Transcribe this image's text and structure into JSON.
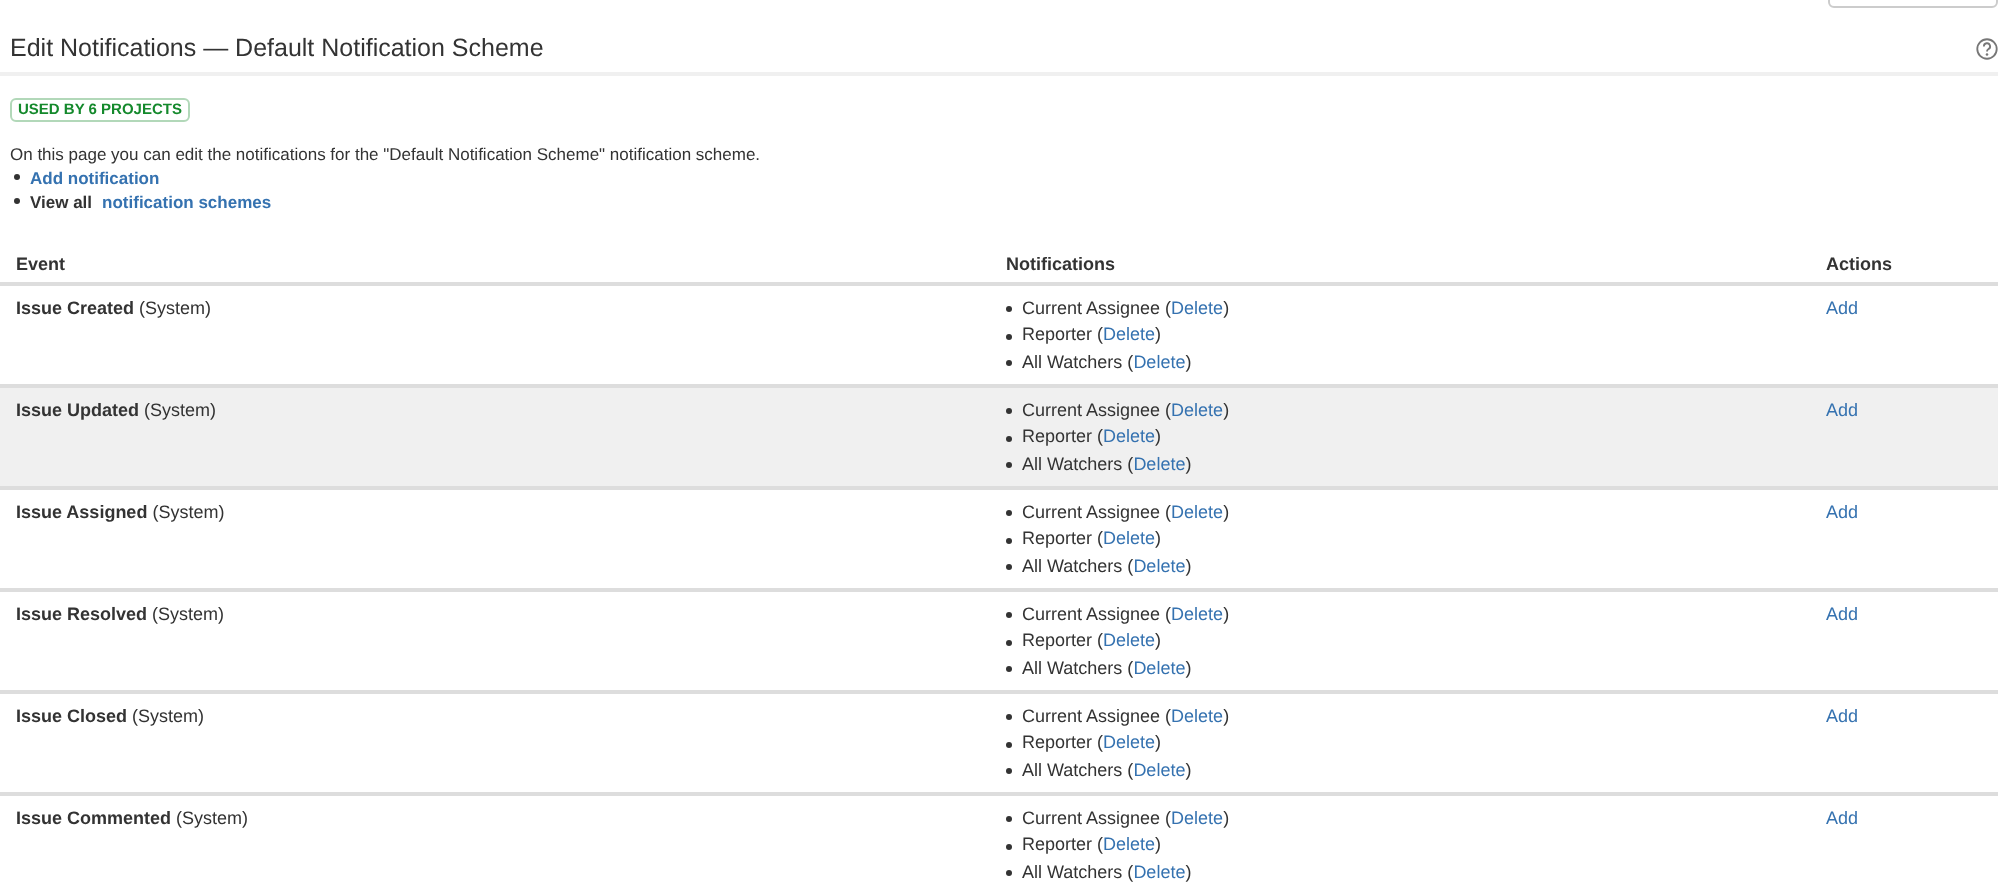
{
  "title": "Edit Notifications — Default Notification Scheme",
  "badge": "USED BY 6 PROJECTS",
  "description": "On this page you can edit the notifications for the \"Default Notification Scheme\" notification scheme.",
  "links": [
    {
      "link": "Add notification"
    },
    {
      "prefix": "View all",
      "link": "notification schemes"
    }
  ],
  "table": {
    "columns": [
      "Event",
      "Notifications",
      "Actions"
    ],
    "rows": [
      {
        "event": "Issue Created",
        "tag": "(System)",
        "highlighted": false,
        "notifications": [
          {
            "name": "Current Assignee (",
            "action": "Delete",
            "close": ")"
          },
          {
            "name": "Reporter (",
            "action": "Delete",
            "close": ")"
          },
          {
            "name": "All Watchers (",
            "action": "Delete",
            "close": ")"
          }
        ],
        "action": "Add"
      },
      {
        "event": "Issue Updated",
        "tag": "(System)",
        "highlighted": true,
        "notifications": [
          {
            "name": "Current Assignee (",
            "action": "Delete",
            "close": ")"
          },
          {
            "name": "Reporter (",
            "action": "Delete",
            "close": ")"
          },
          {
            "name": "All Watchers (",
            "action": "Delete",
            "close": ")"
          }
        ],
        "action": "Add"
      },
      {
        "event": "Issue Assigned",
        "tag": "(System)",
        "highlighted": false,
        "notifications": [
          {
            "name": "Current Assignee (",
            "action": "Delete",
            "close": ")"
          },
          {
            "name": "Reporter (",
            "action": "Delete",
            "close": ")"
          },
          {
            "name": "All Watchers (",
            "action": "Delete",
            "close": ")"
          }
        ],
        "action": "Add"
      },
      {
        "event": "Issue Resolved",
        "tag": "(System)",
        "highlighted": false,
        "notifications": [
          {
            "name": "Current Assignee (",
            "action": "Delete",
            "close": ")"
          },
          {
            "name": "Reporter (",
            "action": "Delete",
            "close": ")"
          },
          {
            "name": "All Watchers (",
            "action": "Delete",
            "close": ")"
          }
        ],
        "action": "Add"
      },
      {
        "event": "Issue Closed",
        "tag": "(System)",
        "highlighted": false,
        "notifications": [
          {
            "name": "Current Assignee (",
            "action": "Delete",
            "close": ")"
          },
          {
            "name": "Reporter (",
            "action": "Delete",
            "close": ")"
          },
          {
            "name": "All Watchers (",
            "action": "Delete",
            "close": ")"
          }
        ],
        "action": "Add"
      },
      {
        "event": "Issue Commented",
        "tag": "(System)",
        "highlighted": false,
        "notifications": [
          {
            "name": "Current Assignee (",
            "action": "Delete",
            "close": ")"
          },
          {
            "name": "Reporter (",
            "action": "Delete",
            "close": ")"
          },
          {
            "name": "All Watchers (",
            "action": "Delete",
            "close": ")"
          }
        ],
        "action": "Add"
      }
    ]
  }
}
